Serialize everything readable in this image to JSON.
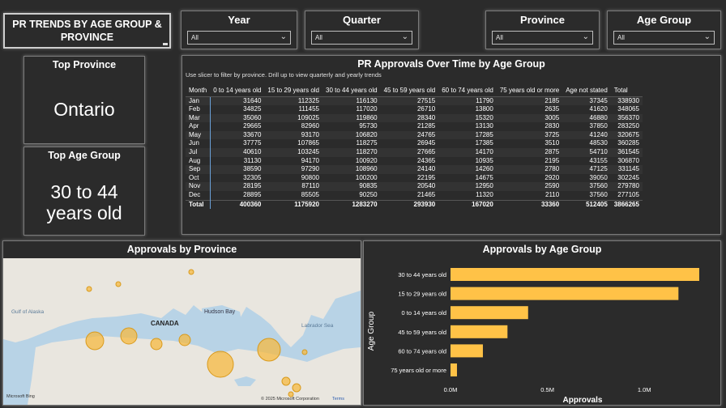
{
  "report": {
    "title": "PR TRENDS BY AGE GROUP & PROVINCE"
  },
  "slicers": {
    "year": {
      "label": "Year",
      "value": "All"
    },
    "quarter": {
      "label": "Quarter",
      "value": "All"
    },
    "province": {
      "label": "Province",
      "value": "All"
    },
    "age_group": {
      "label": "Age Group",
      "value": "All"
    }
  },
  "kpis": {
    "top_province": {
      "label": "Top Province",
      "value": "Ontario"
    },
    "top_age_group": {
      "label": "Top Age Group",
      "value_line1": "30 to 44",
      "value_line2": "years old"
    }
  },
  "table": {
    "title": "PR Approvals Over Time by Age Group",
    "subtitle": "Use slicer to filter by province. Drill up to view quarterly and yearly trends",
    "columns": [
      "Month",
      "0 to 14 years old",
      "15 to 29 years old",
      "30 to 44 years old",
      "45 to 59 years old",
      "60 to 74 years old",
      "75 years old or more",
      "Age not stated",
      "Total"
    ],
    "rows": [
      [
        "Jan",
        "31640",
        "112325",
        "116130",
        "27515",
        "11790",
        "2185",
        "37345",
        "338930"
      ],
      [
        "Feb",
        "34825",
        "111455",
        "117020",
        "26710",
        "13800",
        "2635",
        "41620",
        "348065"
      ],
      [
        "Mar",
        "35060",
        "109025",
        "119860",
        "28340",
        "15320",
        "3005",
        "46880",
        "356370"
      ],
      [
        "Apr",
        "29665",
        "82960",
        "95730",
        "21285",
        "13130",
        "2830",
        "37850",
        "283250"
      ],
      [
        "May",
        "33670",
        "93170",
        "106820",
        "24765",
        "17285",
        "3725",
        "41240",
        "320675"
      ],
      [
        "Jun",
        "37775",
        "107865",
        "118275",
        "26945",
        "17385",
        "3510",
        "48530",
        "360285"
      ],
      [
        "Jul",
        "40610",
        "103245",
        "118270",
        "27665",
        "14170",
        "2875",
        "54710",
        "361545"
      ],
      [
        "Aug",
        "31130",
        "94170",
        "100920",
        "24365",
        "10935",
        "2195",
        "43155",
        "306870"
      ],
      [
        "Sep",
        "38590",
        "97290",
        "108960",
        "24140",
        "14260",
        "2780",
        "47125",
        "331145"
      ],
      [
        "Oct",
        "32305",
        "90800",
        "100200",
        "22195",
        "14675",
        "2920",
        "39050",
        "302245"
      ],
      [
        "Nov",
        "28195",
        "87110",
        "90835",
        "20540",
        "12950",
        "2590",
        "37560",
        "279780"
      ],
      [
        "Dec",
        "28895",
        "85505",
        "90250",
        "21465",
        "11320",
        "2110",
        "37560",
        "277105"
      ]
    ],
    "total": [
      "Total",
      "400360",
      "1175920",
      "1283270",
      "293930",
      "167020",
      "33360",
      "512405",
      "3866265"
    ]
  },
  "map": {
    "title": "Approvals by Province",
    "labels": {
      "country": "CANADA",
      "hudson": "Hudson Bay",
      "alaska": "Gulf of Alaska",
      "labrador": "Labrador Sea"
    },
    "credit": "© 2025 Microsoft Corporation",
    "terms": "Terms",
    "logo": "Microsoft Bing",
    "colors": {
      "land": "#e9e6df",
      "water": "#b8d3e6",
      "bubble": "#f5b942"
    }
  },
  "chart_data": {
    "type": "bar",
    "orientation": "horizontal",
    "title": "Approvals by Age Group",
    "xlabel": "Approvals",
    "ylabel": "Age Group",
    "categories": [
      "30 to 44 years old",
      "15 to 29 years old",
      "0 to 14 years old",
      "45 to 59 years old",
      "60 to 74 years old",
      "75 years old or more"
    ],
    "values": [
      1283270,
      1175920,
      400360,
      293930,
      167020,
      33360
    ],
    "xlim": [
      0,
      1300000
    ],
    "x_ticks": [
      0,
      500000,
      1000000
    ],
    "x_tick_labels": [
      "0.0M",
      "0.5M",
      "1.0M"
    ],
    "color": "#ffc247",
    "grid": false
  }
}
